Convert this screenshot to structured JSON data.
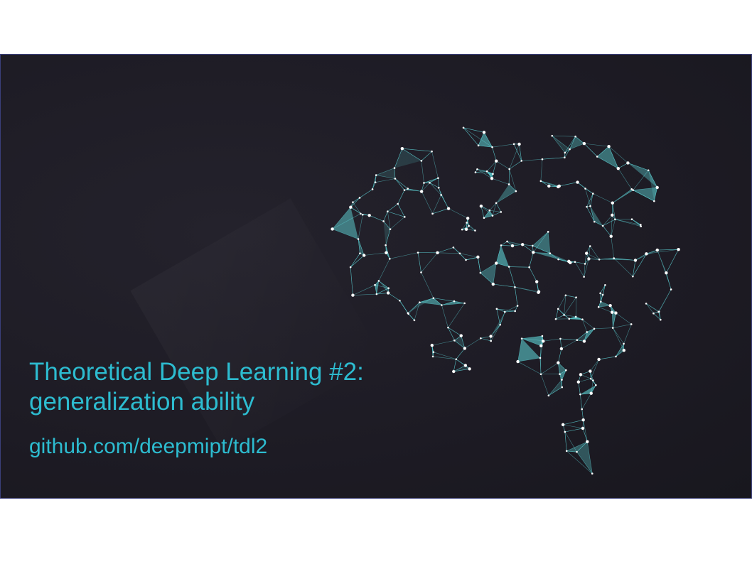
{
  "slide": {
    "title_line1": "Theoretical Deep Learning #2:",
    "title_line2": "generalization ability",
    "link": "github.com/deepmipt/tdl2"
  },
  "colors": {
    "accent": "#2dbcd0",
    "background": "#1d1b24",
    "network_node": "#ffffff",
    "network_edge": "#5fd6d8",
    "border": "#3a3f7a"
  },
  "icons": {
    "illustration": "brain-network-icon"
  }
}
